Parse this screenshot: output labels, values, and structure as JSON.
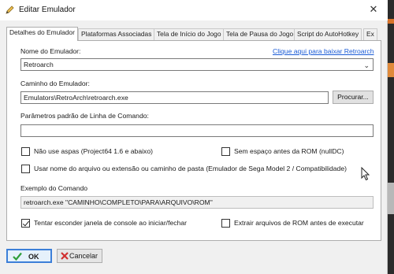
{
  "window": {
    "title": "Editar Emulador",
    "close_glyph": "✕"
  },
  "tabs": [
    {
      "label": "Detalhes do Emulador"
    },
    {
      "label": "Plataformas Associadas"
    },
    {
      "label": "Tela de Início do Jogo"
    },
    {
      "label": "Tela de Pausa do Jogo"
    },
    {
      "label": "Script do AutoHotkey"
    },
    {
      "label": "Ex"
    }
  ],
  "form": {
    "name_label": "Nome do Emulador:",
    "download_link": "Clique aqui para baixar Retroarch",
    "name_value": "Retroarch",
    "path_label": "Caminho do Emulador:",
    "path_value": "Emulators\\RetroArch\\retroarch.exe",
    "browse_button": "Procurar...",
    "params_label": "Parâmetros padrão de Linha de Comando:",
    "params_value": "",
    "no_quotes": {
      "label": "Não use aspas (Project64 1.6 e abaixo)",
      "checked": false
    },
    "no_space": {
      "label": "Sem espaço antes da ROM (nullDC)",
      "checked": false
    },
    "use_filename": {
      "label": "Usar nome do arquivo ou extensão ou caminho de pasta (Emulador de Sega Model 2 / Compatibilidade)",
      "checked": false
    },
    "example_label": "Exemplo do Comando",
    "example_value": "retroarch.exe \"CAMINHO\\COMPLETO\\PARA\\ARQUIVO\\ROM\"",
    "hide_console": {
      "label": "Tentar esconder janela de console ao iniciar/fechar",
      "checked": true
    },
    "extract_roms": {
      "label": "Extrair arquivos de ROM antes de executar",
      "checked": false
    }
  },
  "footer": {
    "ok_label": "OK",
    "cancel_label": "Cancelar"
  },
  "colors": {
    "link": "#1a5bd6",
    "ok_check": "#2e9e3a",
    "cancel_x": "#d12f2f"
  }
}
